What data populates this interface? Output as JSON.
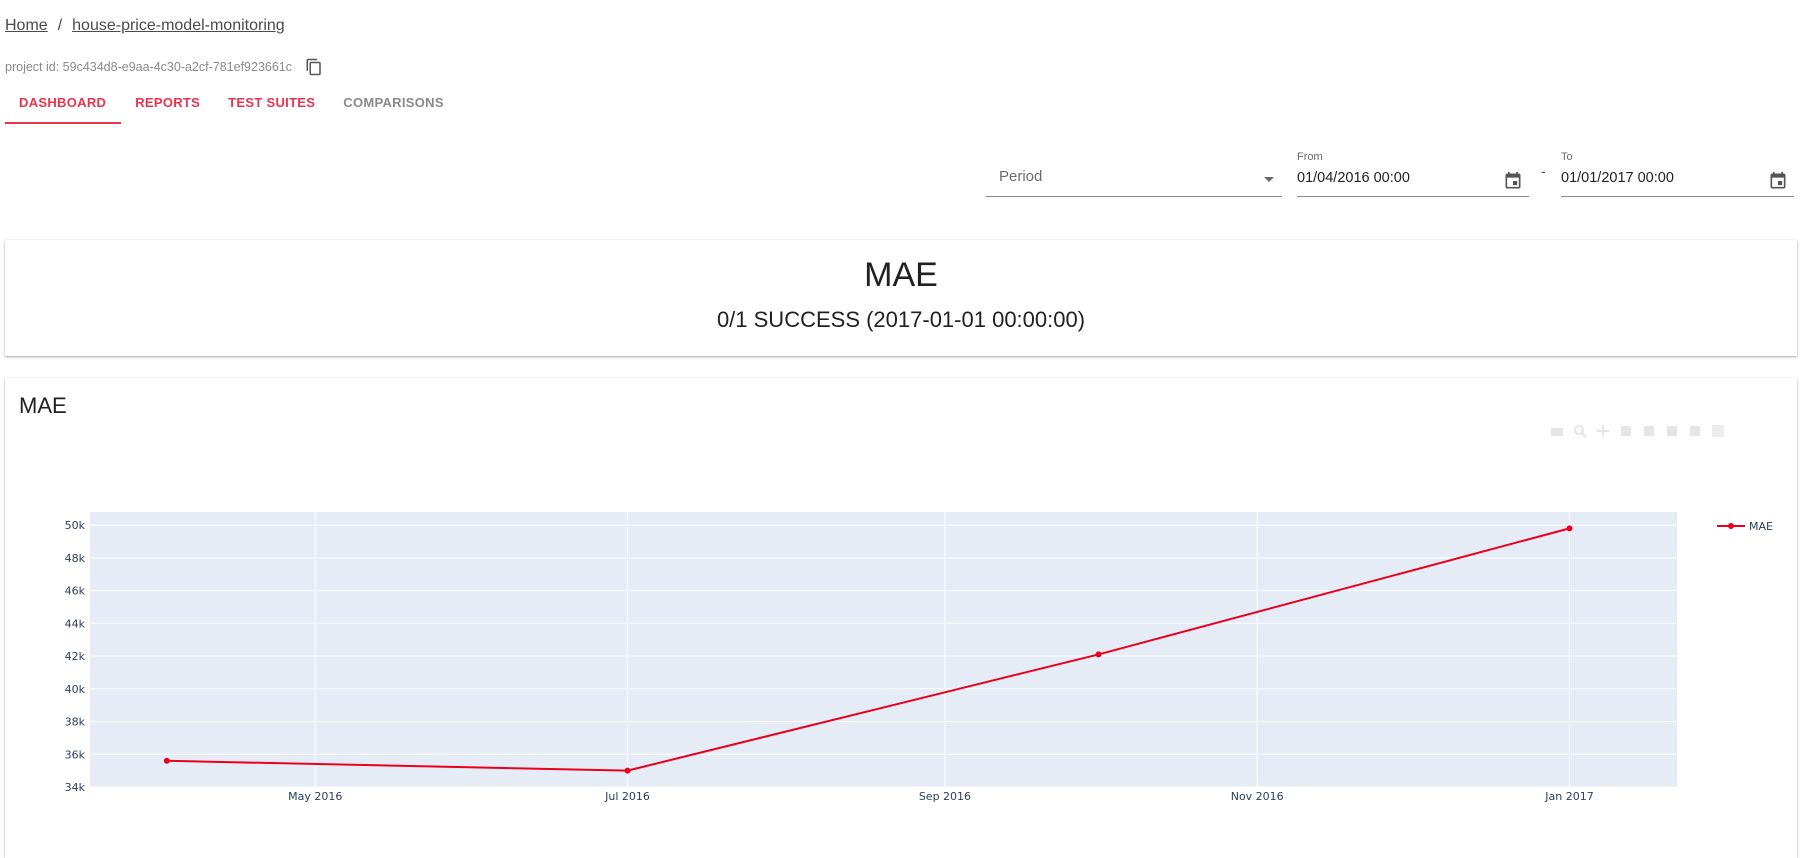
{
  "breadcrumb": {
    "home": "Home",
    "separator": "/",
    "project": "house-price-model-monitoring"
  },
  "project": {
    "id_text": "project id: 59c434d8-e9aa-4c30-a2cf-781ef923661c",
    "copy_icon": "content-copy-icon"
  },
  "tabs": [
    {
      "label": "DASHBOARD",
      "active": true
    },
    {
      "label": "REPORTS",
      "active": false
    },
    {
      "label": "TEST SUITES",
      "active": false
    },
    {
      "label": "COMPARISONS",
      "active": false
    }
  ],
  "filters": {
    "period_label": "Period",
    "from_label": "From",
    "from_value": "01/04/2016 00:00",
    "dash": "-",
    "to_label": "To",
    "to_value": "01/01/2017 00:00",
    "calendar_icon": "calendar-icon"
  },
  "counter": {
    "title": "MAE",
    "value": "0/1 SUCCESS (2017-01-01 00:00:00)"
  },
  "plot": {
    "title": "MAE"
  },
  "colors": {
    "accent": "#e8344e",
    "line": "#e8001c",
    "plot_bg": "#e5ecf6",
    "tick_text": "#2a3f5f"
  },
  "chart_data": {
    "type": "line",
    "x": [
      "2016-04-02",
      "2016-07-01",
      "2016-10-01",
      "2017-01-01"
    ],
    "series": [
      {
        "name": "MAE",
        "values": [
          35600,
          35000,
          42100,
          49800
        ]
      }
    ],
    "ylim": [
      34000,
      50800
    ],
    "yticks": [
      34000,
      36000,
      38000,
      40000,
      42000,
      44000,
      46000,
      48000,
      50000
    ],
    "ytick_labels": [
      "34k",
      "36k",
      "38k",
      "40k",
      "42k",
      "44k",
      "46k",
      "48k",
      "50k"
    ],
    "xticks": [
      "2016-05-01",
      "2016-07-01",
      "2016-09-01",
      "2016-11-01",
      "2017-01-01"
    ],
    "xtick_labels": [
      "May 2016",
      "Jul 2016",
      "Sep 2016",
      "Nov 2016",
      "Jan 2017"
    ],
    "xlim": [
      "2016-03-18",
      "2017-01-22"
    ],
    "grid": true,
    "legend": "top-right"
  }
}
